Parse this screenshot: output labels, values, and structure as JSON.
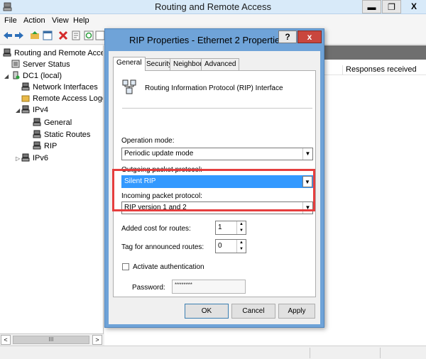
{
  "window": {
    "title": "Routing and Remote Access",
    "min_glyph": "▬",
    "max_glyph": "❐",
    "close_glyph": "X"
  },
  "menu": [
    "File",
    "Action",
    "View",
    "Help"
  ],
  "tree": {
    "items": [
      {
        "label": "Routing and Remote Access"
      },
      {
        "label": "Server Status"
      },
      {
        "label": "DC1 (local)"
      },
      {
        "label": "Network Interfaces"
      },
      {
        "label": "Remote Access Logging"
      },
      {
        "label": "IPv4"
      },
      {
        "label": "General"
      },
      {
        "label": "Static Routes"
      },
      {
        "label": "RIP"
      },
      {
        "label": "IPv6"
      }
    ],
    "scroll_thumb_glyph": "III"
  },
  "right_pane": {
    "column_header": "Responses received"
  },
  "dialog": {
    "title": "RIP Properties - Ethernet 2 Properties",
    "help_glyph": "?",
    "close_glyph": "x",
    "tabs": [
      "General",
      "Security",
      "Neighbors",
      "Advanced"
    ],
    "interface_title": "Routing Information Protocol (RIP) Interface",
    "operation_mode_label": "Operation mode:",
    "operation_mode_value": "Periodic update mode",
    "outgoing_label": "Outgoing packet protocol:",
    "outgoing_value": "Silent RIP",
    "incoming_label": "Incoming packet protocol:",
    "incoming_value": "RIP version 1 and 2",
    "added_cost_label": "Added cost for routes:",
    "added_cost_value": "1",
    "tag_label": "Tag for announced routes:",
    "tag_value": "0",
    "auth_label": "Activate authentication",
    "password_label": "Password:",
    "password_value": "********",
    "ok_label": "OK",
    "cancel_label": "Cancel",
    "apply_label": "Apply"
  },
  "colors": {
    "dialog_frame": "#6fa3d8",
    "selection": "#3399ff",
    "callout": "#e53e3e",
    "close_red": "#c9463d"
  }
}
